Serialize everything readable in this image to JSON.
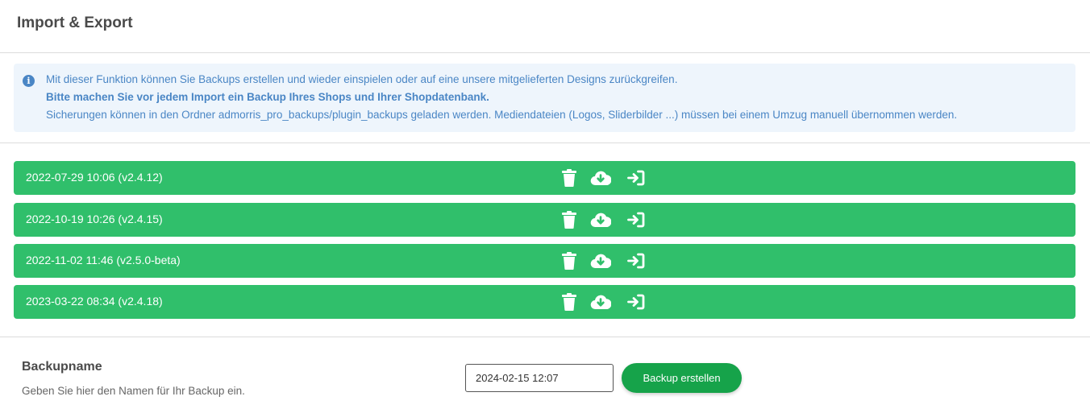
{
  "page": {
    "title": "Import & Export"
  },
  "info": {
    "icon": "info-circle-icon",
    "line1": "Mit dieser Funktion können Sie Backups erstellen und wieder einspielen oder auf eine unsere mitgelieferten Designs zurückgreifen.",
    "line2": "Bitte machen Sie vor jedem Import ein Backup Ihres Shops und Ihrer Shopdatenbank.",
    "line3": "Sicherungen können in den Ordner admorris_pro_backups/plugin_backups geladen werden. Mediendateien (Logos, Sliderbilder ...) müssen bei einem Umzug manuell übernommen werden."
  },
  "backups": [
    {
      "label": "2022-07-29 10:06 (v2.4.12)"
    },
    {
      "label": "2022-10-19 10:26 (v2.4.15)"
    },
    {
      "label": "2022-11-02 11:46 (v2.5.0-beta)"
    },
    {
      "label": "2023-03-22 08:34 (v2.4.18)"
    }
  ],
  "row_actions": [
    "trash-icon",
    "cloud-download-icon",
    "sign-in-icon"
  ],
  "form": {
    "title": "Backupname",
    "help": "Geben Sie hier den Namen für Ihr Backup ein.",
    "input_value": "2024-02-15 12:07",
    "button_label": "Backup erstellen"
  },
  "colors": {
    "row_bg": "#30bf6b",
    "info_bg": "#eef5fc",
    "info_text": "#4a86c5",
    "button_bg": "#16a34a"
  }
}
